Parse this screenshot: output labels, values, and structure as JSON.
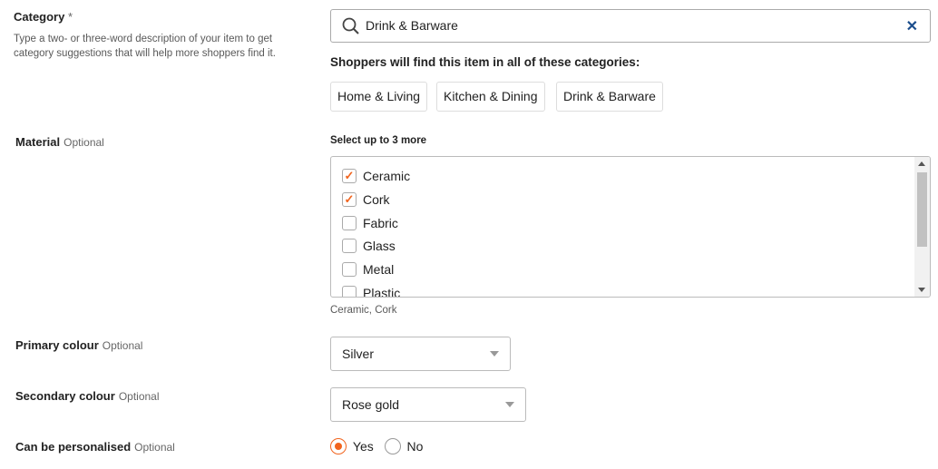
{
  "category": {
    "label": "Category",
    "required_mark": "*",
    "help": "Type a two- or three-word description of your item to get category suggestions that will help more shoppers find it.",
    "search_value": "Drink & Barware",
    "shoppers_heading": "Shoppers will find this item in all of these categories:",
    "tags": [
      "Home & Living",
      "Kitchen & Dining",
      "Drink & Barware"
    ]
  },
  "material": {
    "label": "Material",
    "optional": "Optional",
    "hint": "Select up to 3 more",
    "options": [
      {
        "label": "Ceramic",
        "checked": true
      },
      {
        "label": "Cork",
        "checked": true
      },
      {
        "label": "Fabric",
        "checked": false
      },
      {
        "label": "Glass",
        "checked": false
      },
      {
        "label": "Metal",
        "checked": false
      },
      {
        "label": "Plastic",
        "checked": false
      }
    ],
    "summary": "Ceramic, Cork"
  },
  "primary_colour": {
    "label": "Primary colour",
    "optional": "Optional",
    "value": "Silver"
  },
  "secondary_colour": {
    "label": "Secondary colour",
    "optional": "Optional",
    "value": "Rose gold"
  },
  "personalised": {
    "label": "Can be personalised",
    "optional": "Optional",
    "yes": "Yes",
    "no": "No",
    "selected": "Yes"
  },
  "accent_color": "#f1641e"
}
